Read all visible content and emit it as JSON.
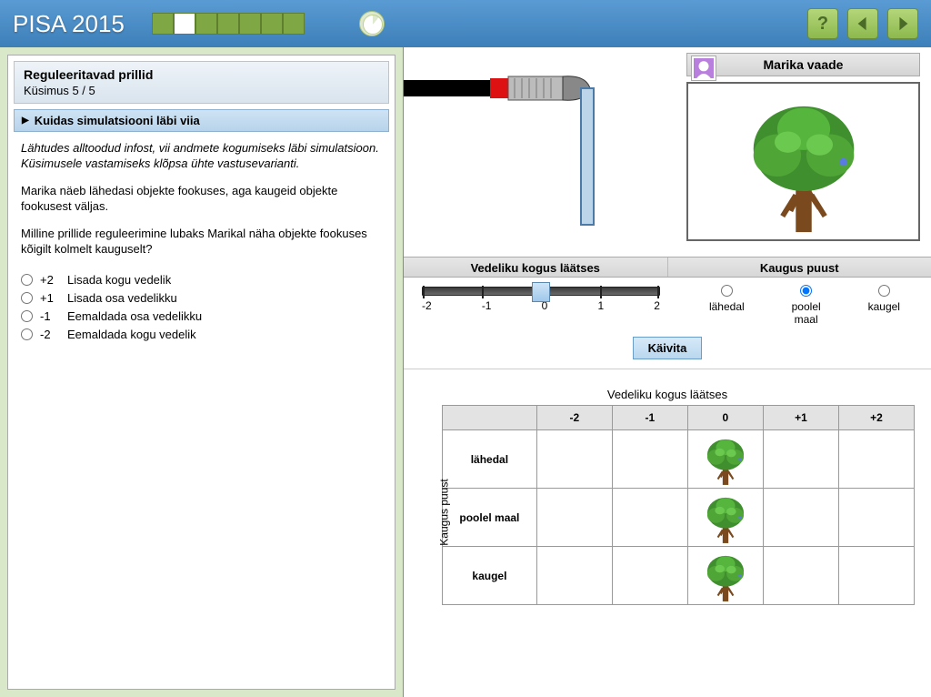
{
  "header": {
    "logo": "PISA 2015",
    "progress_total": 7,
    "progress_current_index": 1
  },
  "question": {
    "title": "Reguleeritavad prillid",
    "subtitle": "Küsimus 5 / 5",
    "accordion_label": "Kuidas simulatsiooni läbi viia",
    "instruction": "Lähtudes alltoodud infost, vii andmete kogumiseks läbi simulatsioon. Küsimusele vastamiseks klõpsa ühte vastusevarianti.",
    "para1": "Marika näeb lähedasi objekte fookuses, aga kaugeid objekte fookusest väljas.",
    "para2": "Milline prillide reguleerimine lubaks Marikal näha objekte fookuses kõigilt kolmelt kauguselt?",
    "options": [
      {
        "num": "+2",
        "text": "Lisada kogu vedelik"
      },
      {
        "num": "+1",
        "text": "Lisada osa vedelikku"
      },
      {
        "num": "-1",
        "text": "Eemaldada osa vedelikku"
      },
      {
        "num": "-2",
        "text": "Eemaldada kogu vedelik"
      }
    ]
  },
  "sim": {
    "view_title": "Marika vaade",
    "slider_label": "Vedeliku kogus läätses",
    "distance_label": "Kaugus puust",
    "slider_ticks": [
      "-2",
      "-1",
      "0",
      "1",
      "2"
    ],
    "slider_value": 0,
    "radio_options": [
      "lähedal",
      "poolel maal",
      "kaugel"
    ],
    "radio_selected_index": 1,
    "run_label": "Käivita"
  },
  "table": {
    "title": "Vedeliku kogus läätses",
    "y_axis": "Kaugus puust",
    "cols": [
      "-2",
      "-1",
      "0",
      "+1",
      "+2"
    ],
    "rows": [
      "lähedal",
      "poolel maal",
      "kaugel"
    ],
    "filled": [
      [
        0,
        2
      ],
      [
        1,
        2
      ],
      [
        2,
        2
      ]
    ]
  },
  "icons": {
    "help": "?",
    "prev": "prev",
    "next": "next"
  }
}
